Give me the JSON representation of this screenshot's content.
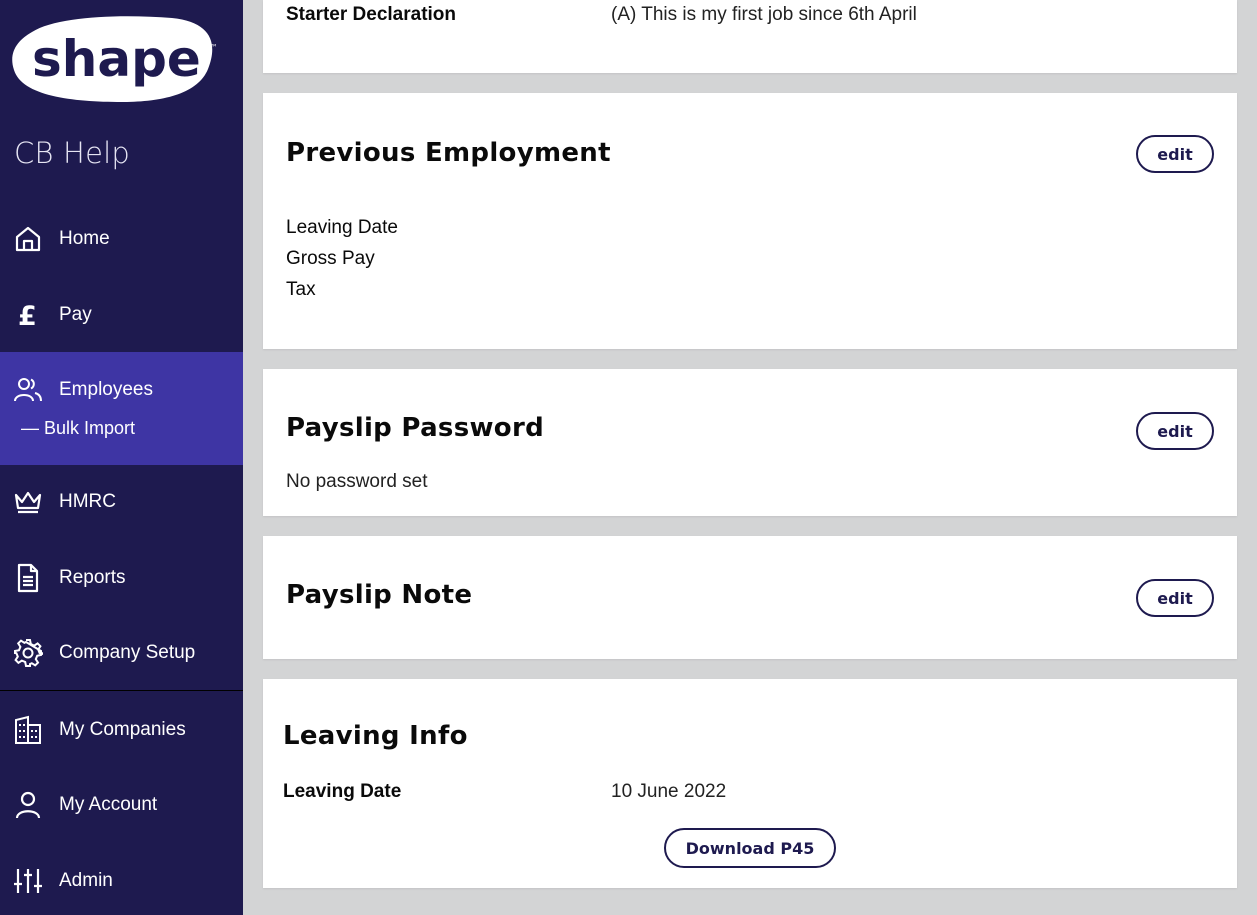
{
  "sidebar": {
    "logo_text": "shape",
    "logo_tm": "™",
    "brand": "CB Help",
    "items": [
      {
        "label": "Home",
        "icon": "home-icon"
      },
      {
        "label": "Pay",
        "icon": "pound-icon"
      },
      {
        "label": "Employees",
        "icon": "people-icon"
      },
      {
        "label": "HMRC",
        "icon": "crown-icon"
      },
      {
        "label": "Reports",
        "icon": "document-icon"
      },
      {
        "label": "Company Setup",
        "icon": "gear-icon"
      },
      {
        "label": "My Companies",
        "icon": "building-icon"
      },
      {
        "label": "My Account",
        "icon": "user-icon"
      },
      {
        "label": "Admin",
        "icon": "sliders-icon"
      }
    ],
    "sub_item": "— Bulk Import",
    "active_item": "Employees",
    "colors": {
      "background": "#1e1a4f",
      "active": "#3e35a4"
    }
  },
  "starter": {
    "label": "Starter Declaration",
    "value": "(A) This is my first job since 6th April"
  },
  "previous_employment": {
    "title": "Previous Employment",
    "edit_label": "edit",
    "rows": [
      "Leaving Date",
      "Gross Pay",
      "Tax"
    ]
  },
  "payslip_password": {
    "title": "Payslip Password",
    "edit_label": "edit",
    "text": "No password set"
  },
  "payslip_note": {
    "title": "Payslip Note",
    "edit_label": "edit"
  },
  "leaving_info": {
    "title": "Leaving Info",
    "leaving_date_label": "Leaving Date",
    "leaving_date_value": "10 June 2022",
    "download_label": "Download P45"
  }
}
